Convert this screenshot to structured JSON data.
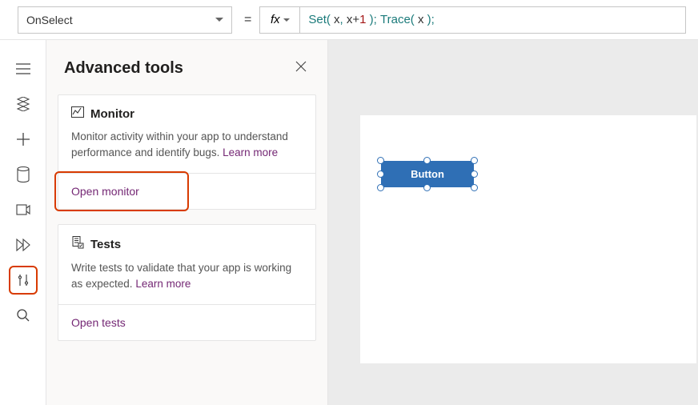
{
  "formula_bar": {
    "property_name": "OnSelect",
    "fx_label": "fx",
    "expression_tokens": [
      {
        "t": "fn",
        "v": "Set"
      },
      {
        "t": "punc",
        "v": "( "
      },
      {
        "t": "plain",
        "v": "x"
      },
      {
        "t": "punc",
        "v": ", "
      },
      {
        "t": "plain",
        "v": "x+"
      },
      {
        "t": "num",
        "v": "1"
      },
      {
        "t": "punc",
        "v": " );"
      },
      {
        "t": "plain",
        "v": " "
      },
      {
        "t": "fn",
        "v": "Trace"
      },
      {
        "t": "punc",
        "v": "( "
      },
      {
        "t": "plain",
        "v": "x"
      },
      {
        "t": "punc",
        "v": " );"
      }
    ],
    "equals": "="
  },
  "panel": {
    "title": "Advanced tools",
    "cards": [
      {
        "title": "Monitor",
        "desc": "Monitor activity within your app to understand performance and identify bugs. ",
        "learn_more": "Learn more",
        "action": "Open monitor"
      },
      {
        "title": "Tests",
        "desc": "Write tests to validate that your app is working as expected. ",
        "learn_more": "Learn more",
        "action": "Open tests"
      }
    ]
  },
  "canvas": {
    "button_label": "Button"
  }
}
